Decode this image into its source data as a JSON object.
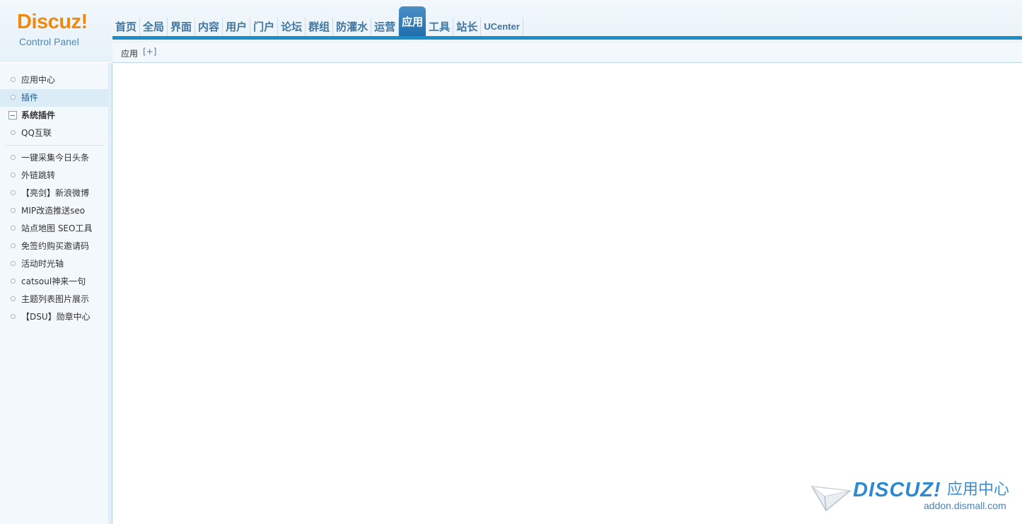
{
  "logo": {
    "wordmark": "Discuz!",
    "subtitle": "Control Panel"
  },
  "topnav": [
    {
      "label": "首页",
      "active": false
    },
    {
      "label": "全局",
      "active": false
    },
    {
      "label": "界面",
      "active": false
    },
    {
      "label": "内容",
      "active": false
    },
    {
      "label": "用户",
      "active": false
    },
    {
      "label": "门户",
      "active": false
    },
    {
      "label": "论坛",
      "active": false
    },
    {
      "label": "群组",
      "active": false
    },
    {
      "label": "防灌水",
      "active": false
    },
    {
      "label": "运营",
      "active": false
    },
    {
      "label": "应用",
      "active": true
    },
    {
      "label": "工具",
      "active": false
    },
    {
      "label": "站长",
      "active": false
    },
    {
      "label": "UCenter",
      "active": false
    }
  ],
  "subbar": {
    "crumb": "应用",
    "add_link": "[+]"
  },
  "sidebar": {
    "items_top": [
      {
        "label": "应用中心"
      },
      {
        "label": "插件",
        "selected": true
      }
    ],
    "group_label": "系统插件",
    "items_group": [
      {
        "label": "QQ互联"
      }
    ],
    "items_plugins": [
      {
        "label": "一键采集今日头条"
      },
      {
        "label": "外链跳转"
      },
      {
        "label": "【亮剑】新浪微博"
      },
      {
        "label": "MIP改造推送seo"
      },
      {
        "label": "站点地图 SEO工具"
      },
      {
        "label": "免签约购买邀请码"
      },
      {
        "label": "活动时光轴"
      },
      {
        "label": "catsoul神来一句"
      },
      {
        "label": "主题列表图片展示"
      },
      {
        "label": "【DSU】勋章中心"
      }
    ]
  },
  "watermark": {
    "brand": "DISCUZ!",
    "label": "应用中心",
    "url": "addon.dismall.com"
  },
  "colors": {
    "accent": "#1a8ec9",
    "nav_text": "#40769f",
    "logo": "#f08a0c",
    "sidebar_bg": "#f2f8fc"
  }
}
